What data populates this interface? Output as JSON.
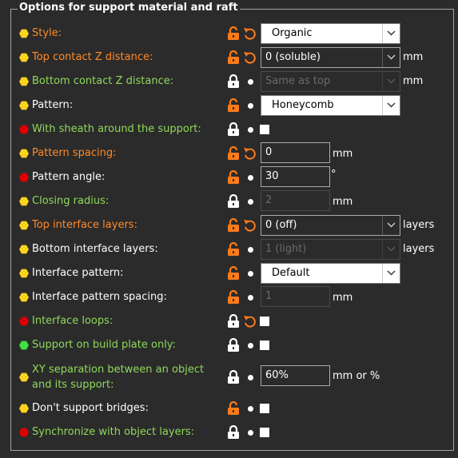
{
  "group": {
    "title": "Options for support material and raft"
  },
  "colors": {
    "yellow": "#ffd21e",
    "red": "#e00000",
    "green": "#3fe03f",
    "label_orange": "#ff8a2a",
    "label_green": "#8fd95b",
    "label_white": "#ffffff",
    "lock_orange": "#ff7b1a",
    "lock_white": "#ffffff"
  },
  "rows": [
    {
      "label": "Style:",
      "value": "Organic",
      "unit": ""
    },
    {
      "label": "Top contact Z distance:",
      "value": "0 (soluble)",
      "unit": "mm"
    },
    {
      "label": "Bottom contact Z distance:",
      "value": "Same as top",
      "unit": "mm"
    },
    {
      "label": "Pattern:",
      "value": "Honeycomb",
      "unit": ""
    },
    {
      "label": "With sheath around the support:",
      "value": "",
      "unit": ""
    },
    {
      "label": "Pattern spacing:",
      "value": "0",
      "unit": "mm"
    },
    {
      "label": "Pattern angle:",
      "value": "30",
      "unit": "°"
    },
    {
      "label": "Closing radius:",
      "value": "2",
      "unit": "mm"
    },
    {
      "label": "Top interface layers:",
      "value": "0 (off)",
      "unit": "layers"
    },
    {
      "label": "Bottom interface layers:",
      "value": "1 (light)",
      "unit": "layers"
    },
    {
      "label": "Interface pattern:",
      "value": "Default",
      "unit": ""
    },
    {
      "label": "Interface pattern spacing:",
      "value": "1",
      "unit": "mm"
    },
    {
      "label": "Interface loops:",
      "value": "",
      "unit": ""
    },
    {
      "label": "Support on build plate only:",
      "value": "",
      "unit": ""
    },
    {
      "label_line1": "XY separation between an object",
      "label_line2": "and its support:",
      "value": "60%",
      "unit": "mm or %"
    },
    {
      "label": "Don't support bridges:",
      "value": "",
      "unit": ""
    },
    {
      "label": "Synchronize with object layers:",
      "value": "",
      "unit": ""
    }
  ],
  "icons": {
    "importance": "hexagon-importance-icon",
    "lock_closed": "lock-icon",
    "lock_open": "unlock-icon",
    "undo": "undo-arrow-icon",
    "system_value": "bullet-icon",
    "dropdown": "chevron-down-icon"
  }
}
